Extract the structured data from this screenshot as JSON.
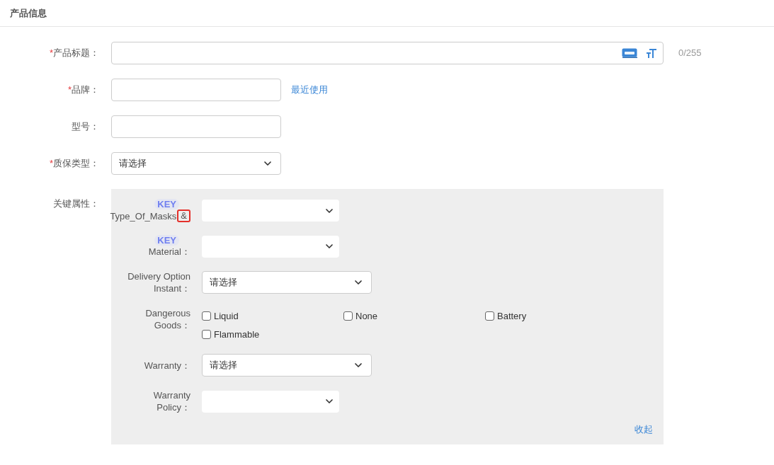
{
  "section_title": "产品信息",
  "fields": [
    {
      "kind": "title_input",
      "required_mark": "*",
      "label": "产品标题：",
      "counter": "0/255"
    },
    {
      "kind": "input",
      "required_mark": "*",
      "label": "品牌：",
      "link": "最近使用"
    },
    {
      "kind": "input",
      "label": "型号："
    },
    {
      "kind": "select",
      "required_mark": "*",
      "label": "质保类型：",
      "value": "请选择"
    }
  ],
  "key_attributes": {
    "label": "关键属性：",
    "collapse_link": "收起",
    "rows": [
      {
        "kind": "plain_select",
        "key_badge": "KEY",
        "label": "Type_Of_Masks",
        "marked_suffix": "&"
      },
      {
        "kind": "plain_select",
        "key_badge": "KEY",
        "label": "Material："
      },
      {
        "kind": "select",
        "label": "Delivery Option Instant：",
        "value": "请选择"
      },
      {
        "kind": "checkboxes",
        "label": "Dangerous Goods：",
        "options": [
          {
            "label": "Liquid",
            "checked": false
          },
          {
            "label": "None",
            "checked": false
          },
          {
            "label": "Battery",
            "checked": false
          },
          {
            "label": "Flammable",
            "checked": false
          }
        ]
      },
      {
        "kind": "select",
        "label": "Warranty：",
        "value": "请选择"
      },
      {
        "kind": "plain_select",
        "label": "Warranty Policy："
      }
    ]
  }
}
